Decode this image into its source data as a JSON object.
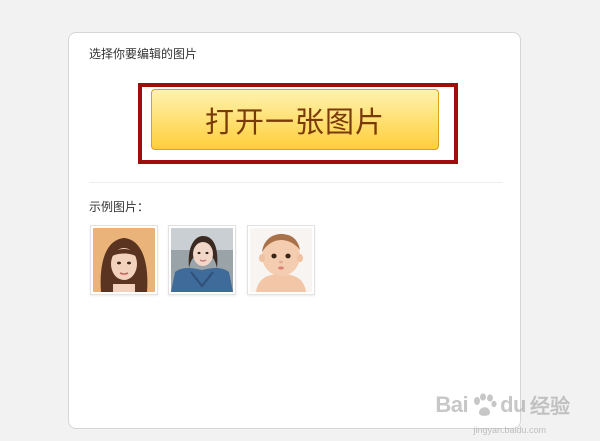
{
  "panel": {
    "select_label": "选择你要编辑的图片",
    "open_button_label": "打开一张图片",
    "examples_label": "示例图片："
  },
  "examples": [
    {
      "name": "sample-woman-bob-haircut"
    },
    {
      "name": "sample-woman-denim-jacket"
    },
    {
      "name": "sample-baby"
    }
  ],
  "watermark": {
    "logo_text": "Bai",
    "logo_text_2": "du",
    "product": "经验",
    "url": "jingyan.baidu.com"
  },
  "colors": {
    "page_bg": "#f2f2f2",
    "highlight": "#a10d0d",
    "button_top": "#fff3b0",
    "button_bottom": "#ffcf3a",
    "button_text": "#7a3a08"
  }
}
